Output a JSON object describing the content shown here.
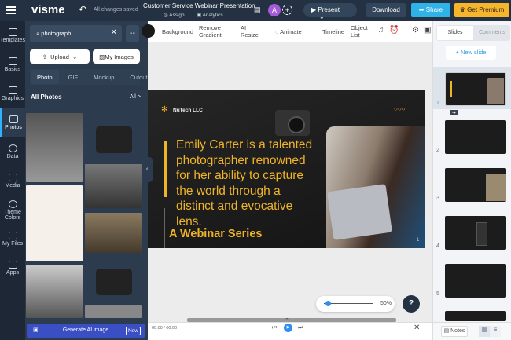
{
  "header": {
    "app_name": "visme",
    "save_status": "All changes saved",
    "title": "Customer Service Webinar Presentation",
    "assign": "Assign",
    "analytics": "Analytics",
    "avatar": "A",
    "present": "Present",
    "download": "Download",
    "share": "Share",
    "premium": "Get Premium"
  },
  "rail": [
    {
      "label": "Templates"
    },
    {
      "label": "Basics"
    },
    {
      "label": "Graphics"
    },
    {
      "label": "Photos"
    },
    {
      "label": "Data"
    },
    {
      "label": "Media"
    },
    {
      "label": "Theme Colors"
    },
    {
      "label": "My Files"
    },
    {
      "label": "Apps"
    }
  ],
  "panel": {
    "search_value": "photograph",
    "upload": "Upload",
    "my_images": "My Images",
    "tabs": [
      "Photo",
      "GIF",
      "Mockup",
      "Cutout"
    ],
    "section": "All Photos",
    "all": "All >",
    "generate": "Generate AI image",
    "new_badge": "New"
  },
  "toolbar": {
    "background": "Background",
    "remove_gradient": "Remove Gradient",
    "ai_resize": "AI Resize",
    "animate": "Animate",
    "timeline": "Timeline",
    "object_list": "Object List"
  },
  "slide": {
    "company": "NuTech LLC",
    "body": "Emily Carter is a talented photographer renowned for her ability to capture the world through a distinct and evocative lens.",
    "subtitle": "A Webinar Series",
    "page": "1"
  },
  "right": {
    "tabs": [
      "Slides",
      "Comments"
    ],
    "new_slide": "+ New slide",
    "slide_numbers": [
      "1",
      "2",
      "3",
      "4",
      "5"
    ],
    "notes": "Notes"
  },
  "zoom": {
    "value": "50%",
    "fraction": 0.1
  },
  "playback": {
    "time": "00:00 / 00:00"
  },
  "colors": {
    "accent": "#f0b429",
    "share": "#2fb2e8",
    "premium": "#f7b52c"
  }
}
